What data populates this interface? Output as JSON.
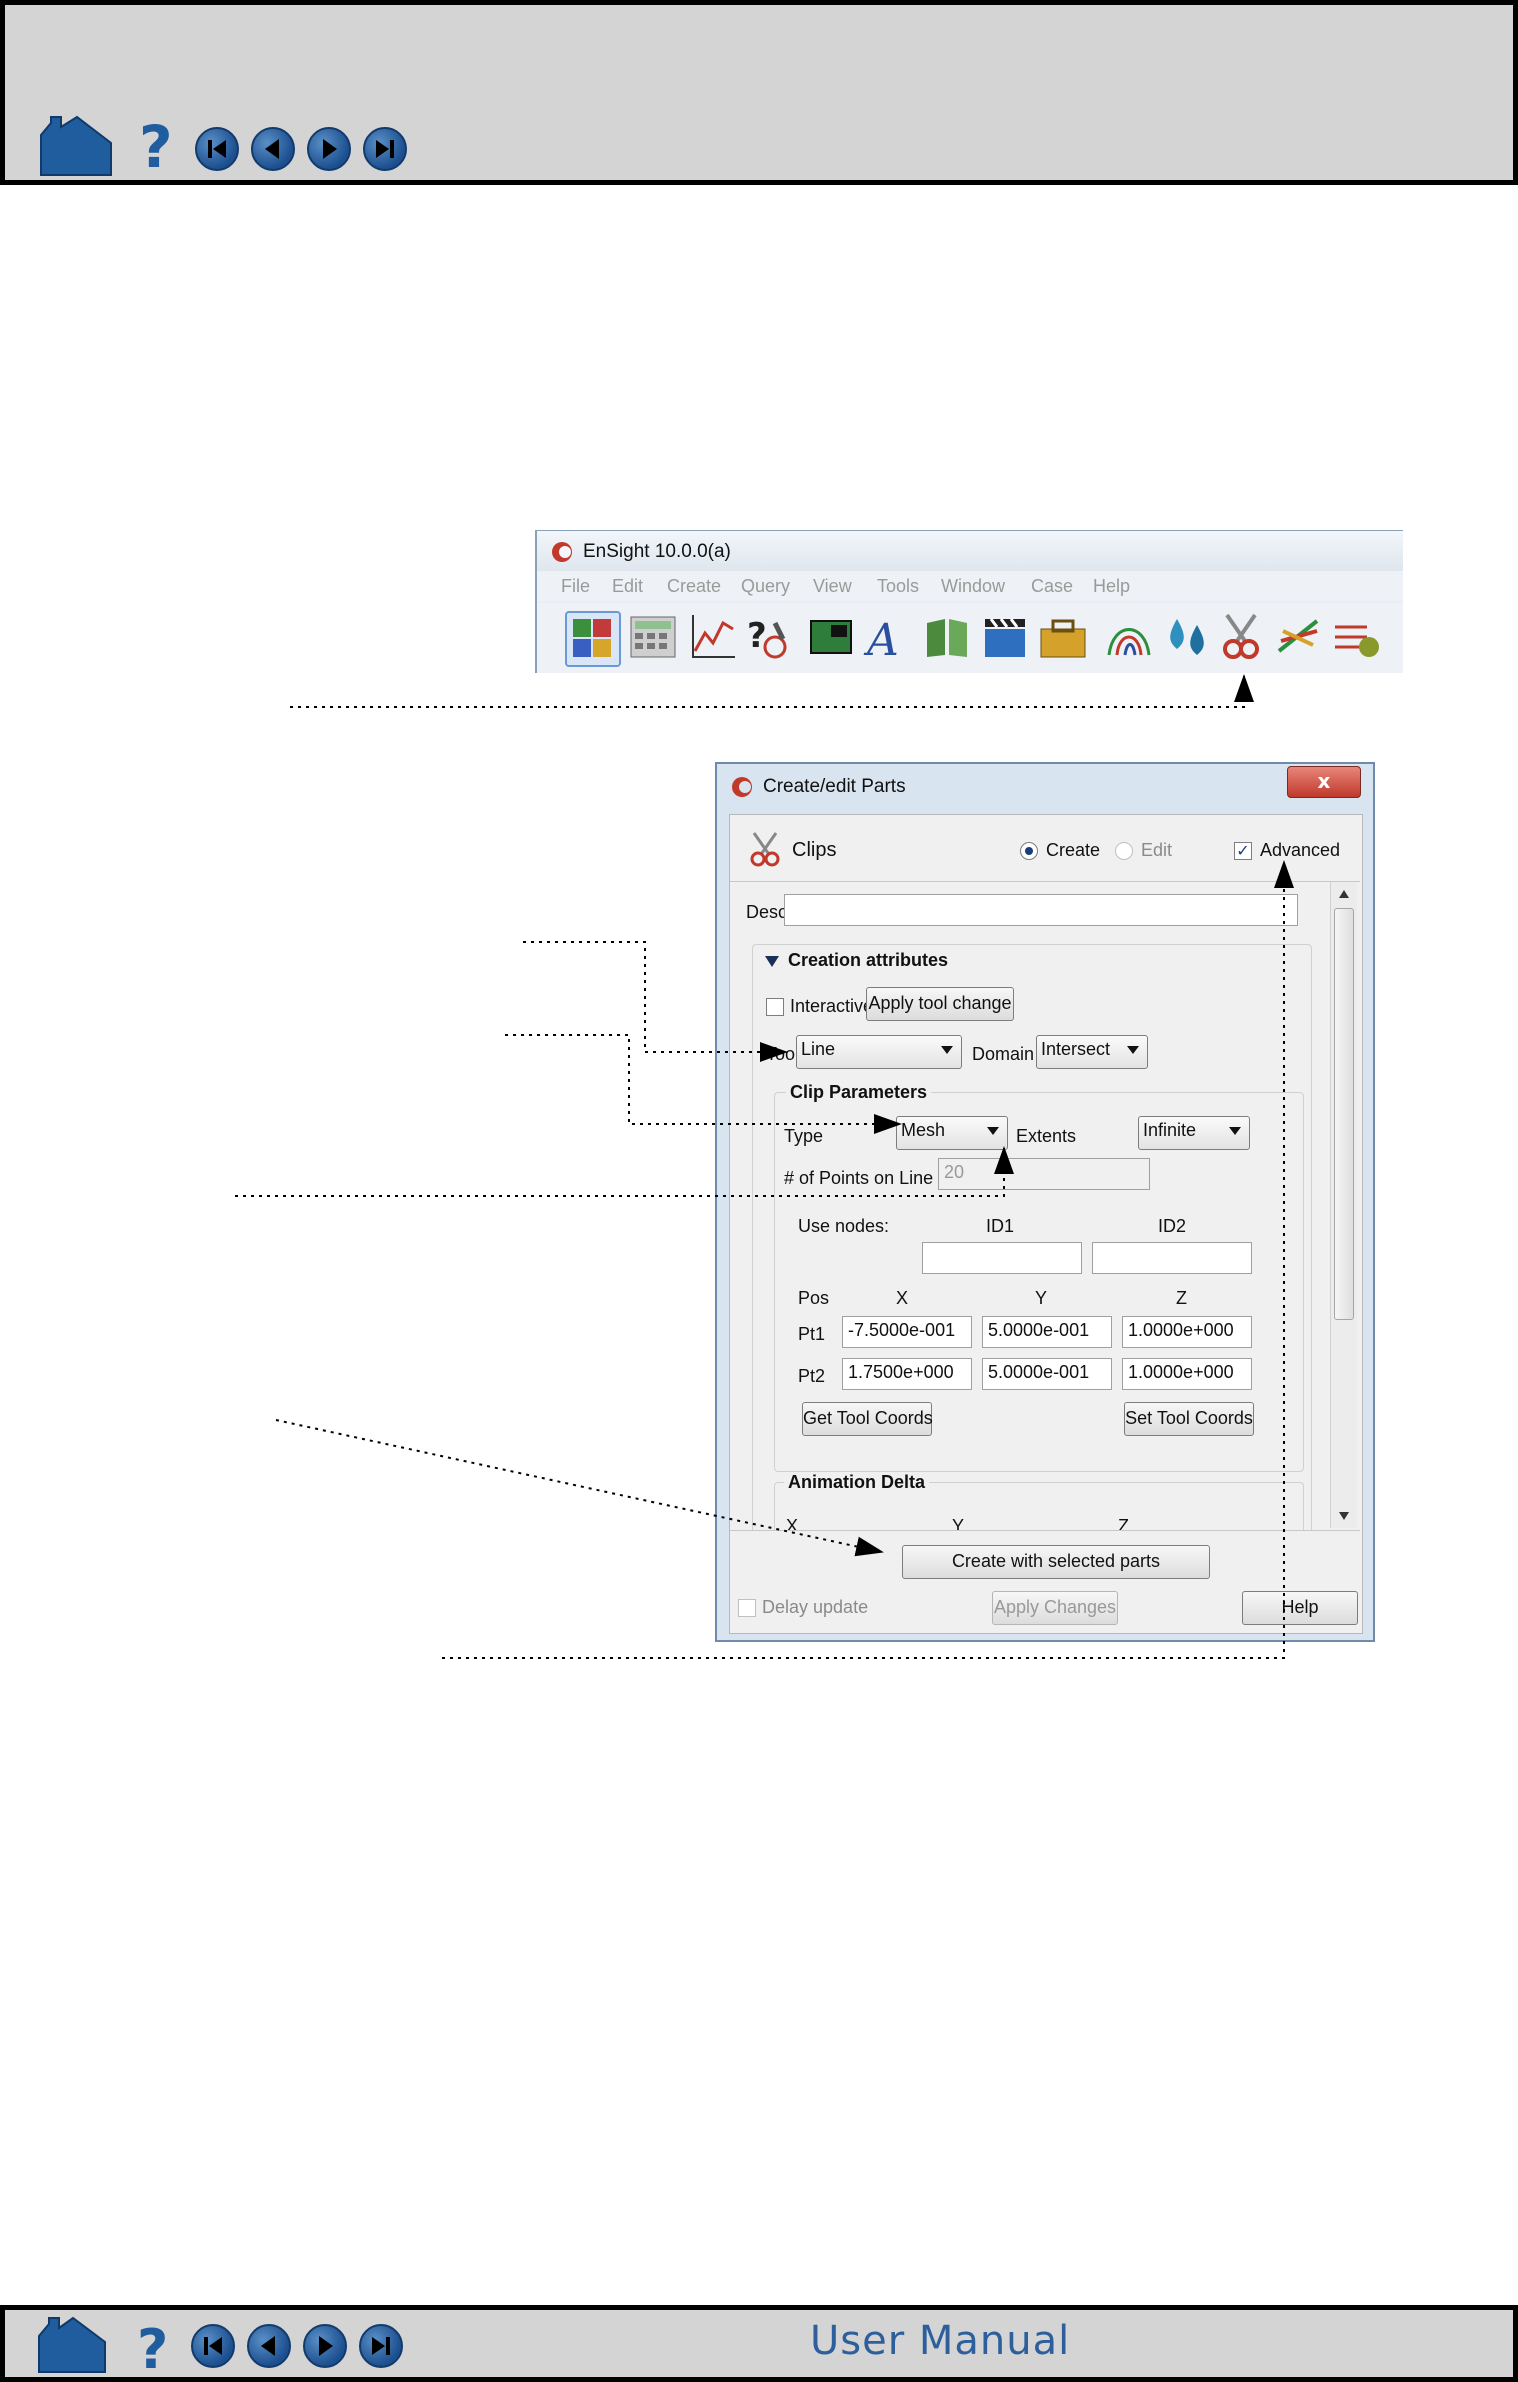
{
  "footer": {
    "title": "User Manual"
  },
  "ensight": {
    "title": "EnSight 10.0.0(a)",
    "menu": [
      "File",
      "Edit",
      "Create",
      "Query",
      "View",
      "Tools",
      "Window",
      "Case",
      "Help"
    ]
  },
  "dialog": {
    "title": "Create/edit Parts",
    "close": "x",
    "header": {
      "label": "Clips",
      "create": "Create",
      "edit": "Edit",
      "advanced": "Advanced"
    },
    "desc_label": "Desc.",
    "creation": {
      "heading": "Creation attributes",
      "interactive": "Interactive",
      "apply_tool_change": "Apply tool change",
      "tool_label": "Tool",
      "tool_value": "Line",
      "domain_label": "Domain",
      "domain_value": "Intersect"
    },
    "clip": {
      "heading": "Clip Parameters",
      "type_label": "Type",
      "type_value": "Mesh",
      "extents_label": "Extents",
      "extents_value": "Infinite",
      "points_label": "# of Points on Line",
      "points_value": "20",
      "use_nodes": "Use nodes:",
      "id1": "ID1",
      "id2": "ID2",
      "pos": "Pos",
      "x": "X",
      "y": "Y",
      "z": "Z",
      "pt1": {
        "label": "Pt1",
        "x": "-7.5000e-001",
        "y": "5.0000e-001",
        "z": "1.0000e+000"
      },
      "pt2": {
        "label": "Pt2",
        "x": "1.7500e+000",
        "y": "5.0000e-001",
        "z": "1.0000e+000"
      },
      "get_tool": "Get Tool Coords",
      "set_tool": "Set Tool Coords"
    },
    "animation": {
      "heading": "Animation Delta",
      "x": "X",
      "y": "Y",
      "z": "Z"
    },
    "create_button": "Create with selected parts",
    "delay_update": "Delay update",
    "apply_changes": "Apply Changes",
    "help": "Help"
  }
}
